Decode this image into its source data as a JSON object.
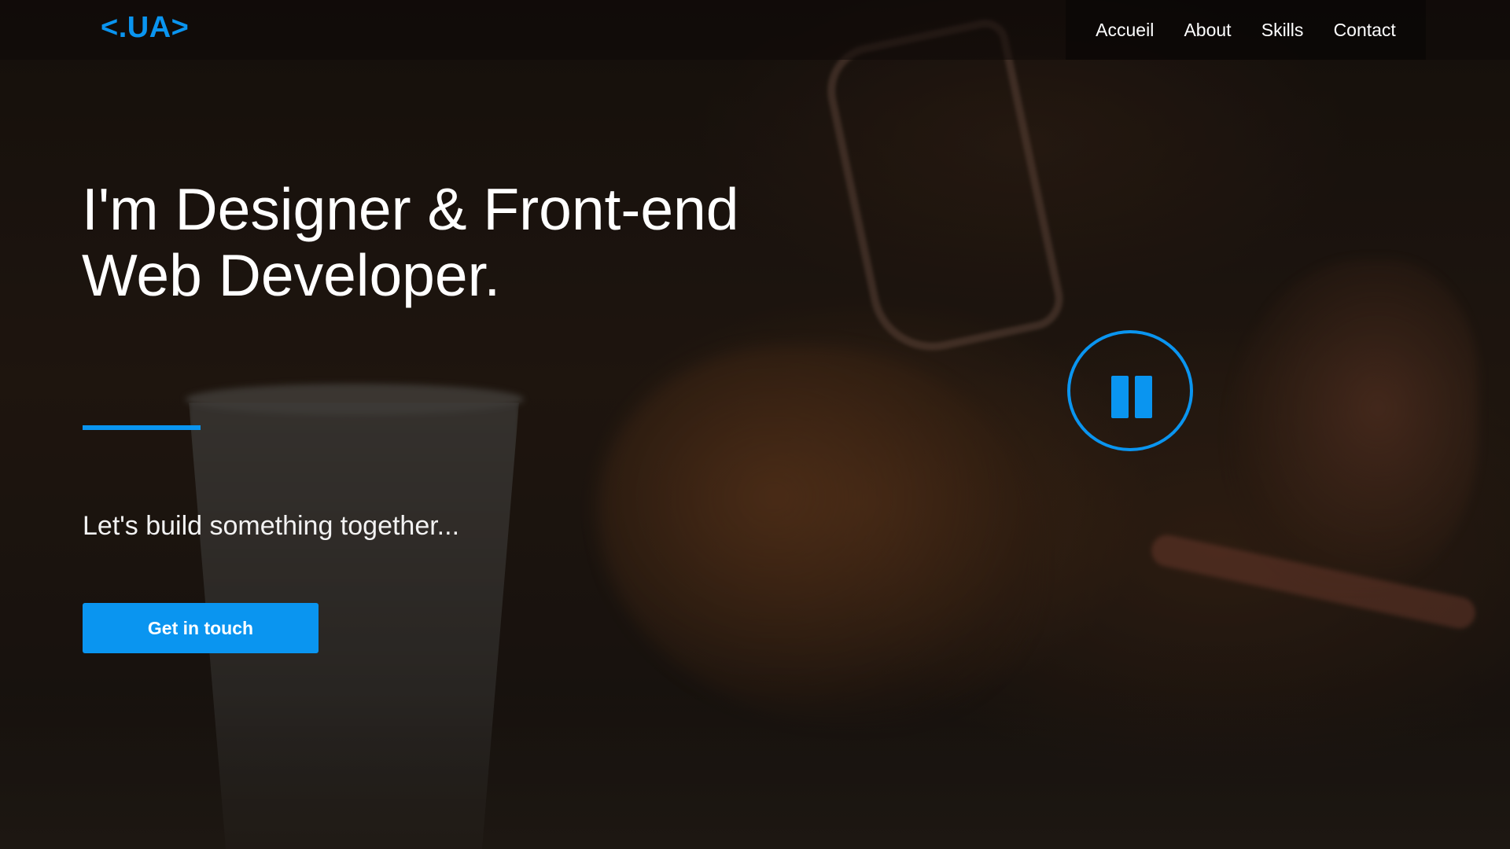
{
  "site": {
    "logo_text": "<.UA>",
    "accent_color": "#0a95f0"
  },
  "nav": {
    "items": [
      {
        "label": "Accueil"
      },
      {
        "label": "About"
      },
      {
        "label": "Skills"
      },
      {
        "label": "Contact"
      }
    ]
  },
  "hero": {
    "headline_line1": "I'm Designer & Front-end",
    "headline_line2": "Web Developer.",
    "tagline": "Let's build something together...",
    "cta_label": "Get in touch",
    "video_control_icon": "pause-icon"
  }
}
